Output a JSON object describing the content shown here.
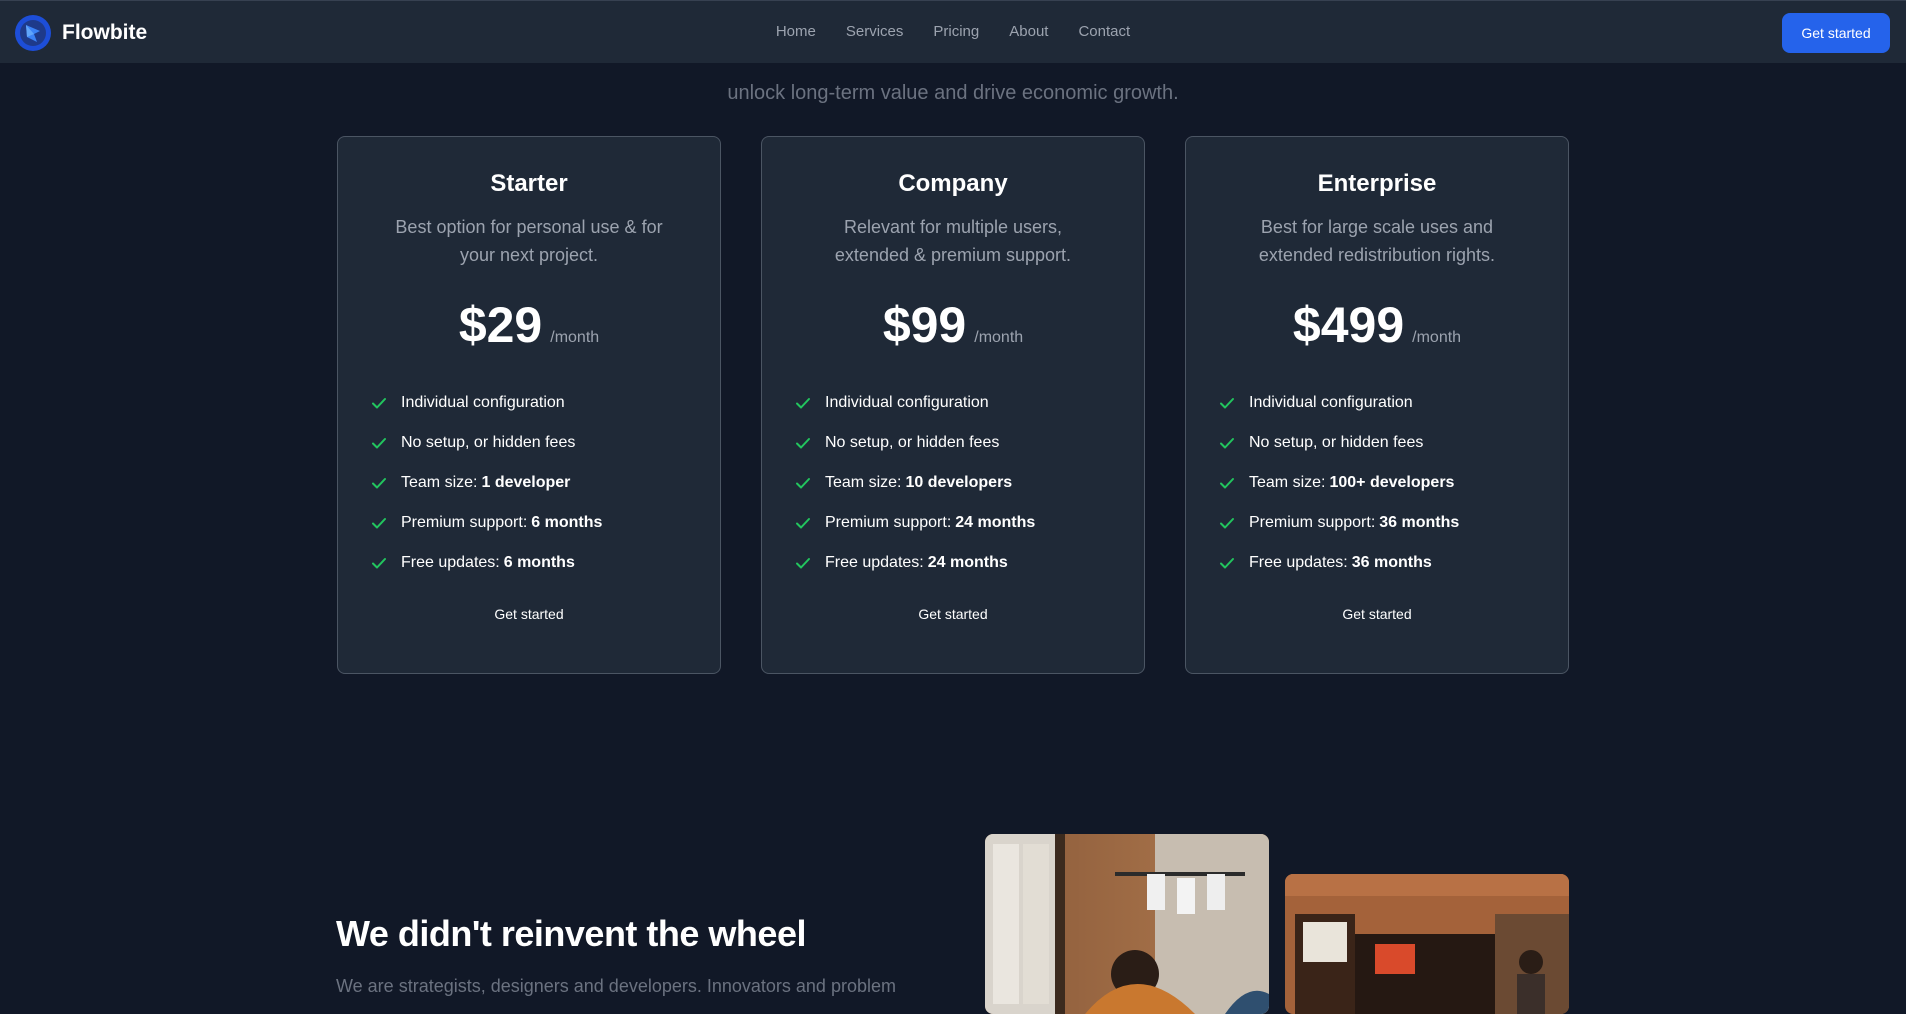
{
  "nav": {
    "brand": "Flowbite",
    "links": [
      "Home",
      "Services",
      "Pricing",
      "About",
      "Contact"
    ],
    "cta": "Get started"
  },
  "hero": {
    "tail_text": "unlock long-term value and drive economic growth."
  },
  "colors": {
    "accent": "#2563eb",
    "check": "#22c55e",
    "background": "#111827",
    "card": "#1f2937"
  },
  "plans": [
    {
      "name": "Starter",
      "description": "Best option for personal use & for your next project.",
      "price": "$29",
      "period": "/month",
      "features": [
        {
          "label": "Individual configuration",
          "value": ""
        },
        {
          "label": "No setup, or hidden fees",
          "value": ""
        },
        {
          "label": "Team size:",
          "value": "1 developer"
        },
        {
          "label": "Premium support:",
          "value": "6 months"
        },
        {
          "label": "Free updates:",
          "value": "6 months"
        }
      ],
      "cta": "Get started"
    },
    {
      "name": "Company",
      "description": "Relevant for multiple users, extended & premium support.",
      "price": "$99",
      "period": "/month",
      "features": [
        {
          "label": "Individual configuration",
          "value": ""
        },
        {
          "label": "No setup, or hidden fees",
          "value": ""
        },
        {
          "label": "Team size:",
          "value": "10 developers"
        },
        {
          "label": "Premium support:",
          "value": "24 months"
        },
        {
          "label": "Free updates:",
          "value": "24 months"
        }
      ],
      "cta": "Get started"
    },
    {
      "name": "Enterprise",
      "description": "Best for large scale uses and extended redistribution rights.",
      "price": "$499",
      "period": "/month",
      "features": [
        {
          "label": "Individual configuration",
          "value": ""
        },
        {
          "label": "No setup, or hidden fees",
          "value": ""
        },
        {
          "label": "Team size:",
          "value": "100+ developers"
        },
        {
          "label": "Premium support:",
          "value": "36 months"
        },
        {
          "label": "Free updates:",
          "value": "36 months"
        }
      ],
      "cta": "Get started"
    }
  ],
  "feature_section": {
    "heading": "We didn't reinvent the wheel",
    "text": "We are strategists, designers and developers. Innovators and problem"
  }
}
